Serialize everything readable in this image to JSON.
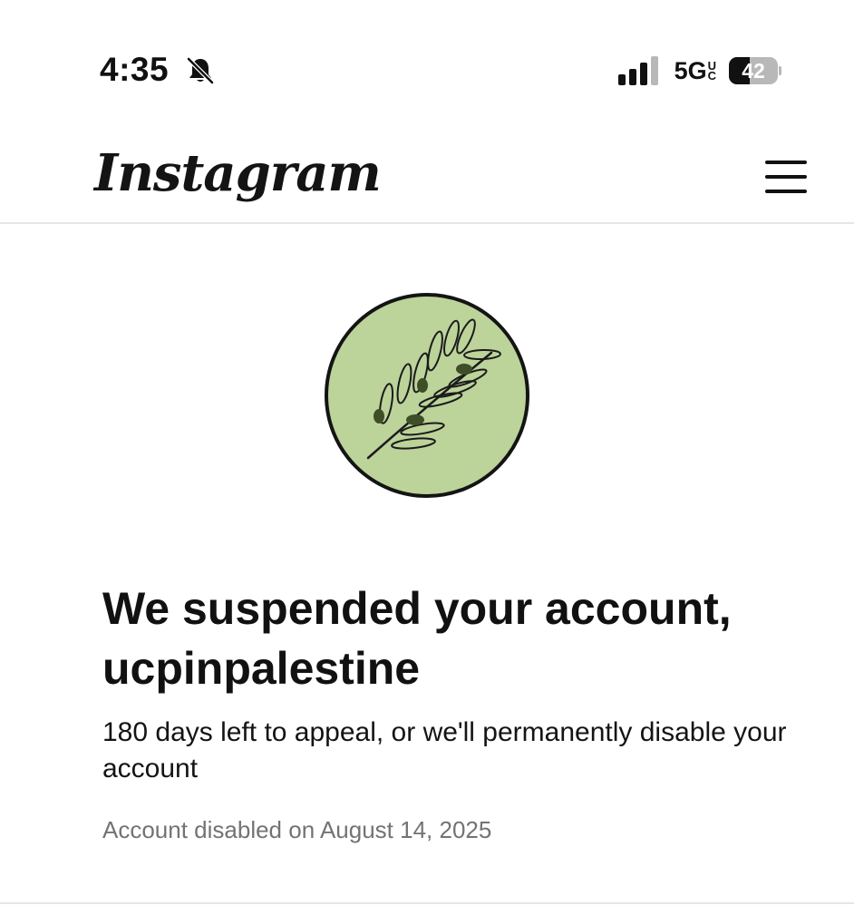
{
  "status_bar": {
    "time": "4:35",
    "network": "5G",
    "network_suffix_top": "U",
    "network_suffix_bottom": "C",
    "battery_percent": "42",
    "silent_icon": "bell-slash-icon",
    "signal_icon": "cellular-signal-icon"
  },
  "header": {
    "logo_text": "Instagram",
    "menu_icon": "hamburger-menu-icon"
  },
  "profile": {
    "avatar_icon": "olive-branch-icon",
    "avatar_bg_color": "#bcd39a"
  },
  "content": {
    "title": "We suspended your account, ucpinpalestine",
    "subtitle": "180 days left to appeal, or we'll permanently disable your account",
    "disabled_note": "Account disabled on August 14, 2025"
  }
}
